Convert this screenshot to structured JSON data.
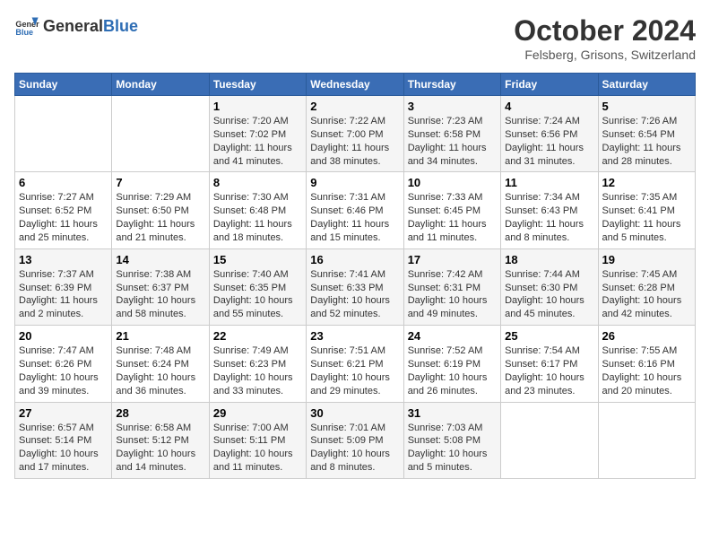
{
  "header": {
    "logo_general": "General",
    "logo_blue": "Blue",
    "month": "October 2024",
    "location": "Felsberg, Grisons, Switzerland"
  },
  "days_of_week": [
    "Sunday",
    "Monday",
    "Tuesday",
    "Wednesday",
    "Thursday",
    "Friday",
    "Saturday"
  ],
  "weeks": [
    [
      null,
      null,
      {
        "day": 1,
        "sunrise": "7:20 AM",
        "sunset": "7:02 PM",
        "daylight": "11 hours and 41 minutes."
      },
      {
        "day": 2,
        "sunrise": "7:22 AM",
        "sunset": "7:00 PM",
        "daylight": "11 hours and 38 minutes."
      },
      {
        "day": 3,
        "sunrise": "7:23 AM",
        "sunset": "6:58 PM",
        "daylight": "11 hours and 34 minutes."
      },
      {
        "day": 4,
        "sunrise": "7:24 AM",
        "sunset": "6:56 PM",
        "daylight": "11 hours and 31 minutes."
      },
      {
        "day": 5,
        "sunrise": "7:26 AM",
        "sunset": "6:54 PM",
        "daylight": "11 hours and 28 minutes."
      }
    ],
    [
      {
        "day": 6,
        "sunrise": "7:27 AM",
        "sunset": "6:52 PM",
        "daylight": "11 hours and 25 minutes."
      },
      {
        "day": 7,
        "sunrise": "7:29 AM",
        "sunset": "6:50 PM",
        "daylight": "11 hours and 21 minutes."
      },
      {
        "day": 8,
        "sunrise": "7:30 AM",
        "sunset": "6:48 PM",
        "daylight": "11 hours and 18 minutes."
      },
      {
        "day": 9,
        "sunrise": "7:31 AM",
        "sunset": "6:46 PM",
        "daylight": "11 hours and 15 minutes."
      },
      {
        "day": 10,
        "sunrise": "7:33 AM",
        "sunset": "6:45 PM",
        "daylight": "11 hours and 11 minutes."
      },
      {
        "day": 11,
        "sunrise": "7:34 AM",
        "sunset": "6:43 PM",
        "daylight": "11 hours and 8 minutes."
      },
      {
        "day": 12,
        "sunrise": "7:35 AM",
        "sunset": "6:41 PM",
        "daylight": "11 hours and 5 minutes."
      }
    ],
    [
      {
        "day": 13,
        "sunrise": "7:37 AM",
        "sunset": "6:39 PM",
        "daylight": "11 hours and 2 minutes."
      },
      {
        "day": 14,
        "sunrise": "7:38 AM",
        "sunset": "6:37 PM",
        "daylight": "10 hours and 58 minutes."
      },
      {
        "day": 15,
        "sunrise": "7:40 AM",
        "sunset": "6:35 PM",
        "daylight": "10 hours and 55 minutes."
      },
      {
        "day": 16,
        "sunrise": "7:41 AM",
        "sunset": "6:33 PM",
        "daylight": "10 hours and 52 minutes."
      },
      {
        "day": 17,
        "sunrise": "7:42 AM",
        "sunset": "6:31 PM",
        "daylight": "10 hours and 49 minutes."
      },
      {
        "day": 18,
        "sunrise": "7:44 AM",
        "sunset": "6:30 PM",
        "daylight": "10 hours and 45 minutes."
      },
      {
        "day": 19,
        "sunrise": "7:45 AM",
        "sunset": "6:28 PM",
        "daylight": "10 hours and 42 minutes."
      }
    ],
    [
      {
        "day": 20,
        "sunrise": "7:47 AM",
        "sunset": "6:26 PM",
        "daylight": "10 hours and 39 minutes."
      },
      {
        "day": 21,
        "sunrise": "7:48 AM",
        "sunset": "6:24 PM",
        "daylight": "10 hours and 36 minutes."
      },
      {
        "day": 22,
        "sunrise": "7:49 AM",
        "sunset": "6:23 PM",
        "daylight": "10 hours and 33 minutes."
      },
      {
        "day": 23,
        "sunrise": "7:51 AM",
        "sunset": "6:21 PM",
        "daylight": "10 hours and 29 minutes."
      },
      {
        "day": 24,
        "sunrise": "7:52 AM",
        "sunset": "6:19 PM",
        "daylight": "10 hours and 26 minutes."
      },
      {
        "day": 25,
        "sunrise": "7:54 AM",
        "sunset": "6:17 PM",
        "daylight": "10 hours and 23 minutes."
      },
      {
        "day": 26,
        "sunrise": "7:55 AM",
        "sunset": "6:16 PM",
        "daylight": "10 hours and 20 minutes."
      }
    ],
    [
      {
        "day": 27,
        "sunrise": "6:57 AM",
        "sunset": "5:14 PM",
        "daylight": "10 hours and 17 minutes."
      },
      {
        "day": 28,
        "sunrise": "6:58 AM",
        "sunset": "5:12 PM",
        "daylight": "10 hours and 14 minutes."
      },
      {
        "day": 29,
        "sunrise": "7:00 AM",
        "sunset": "5:11 PM",
        "daylight": "10 hours and 11 minutes."
      },
      {
        "day": 30,
        "sunrise": "7:01 AM",
        "sunset": "5:09 PM",
        "daylight": "10 hours and 8 minutes."
      },
      {
        "day": 31,
        "sunrise": "7:03 AM",
        "sunset": "5:08 PM",
        "daylight": "10 hours and 5 minutes."
      },
      null,
      null
    ]
  ]
}
